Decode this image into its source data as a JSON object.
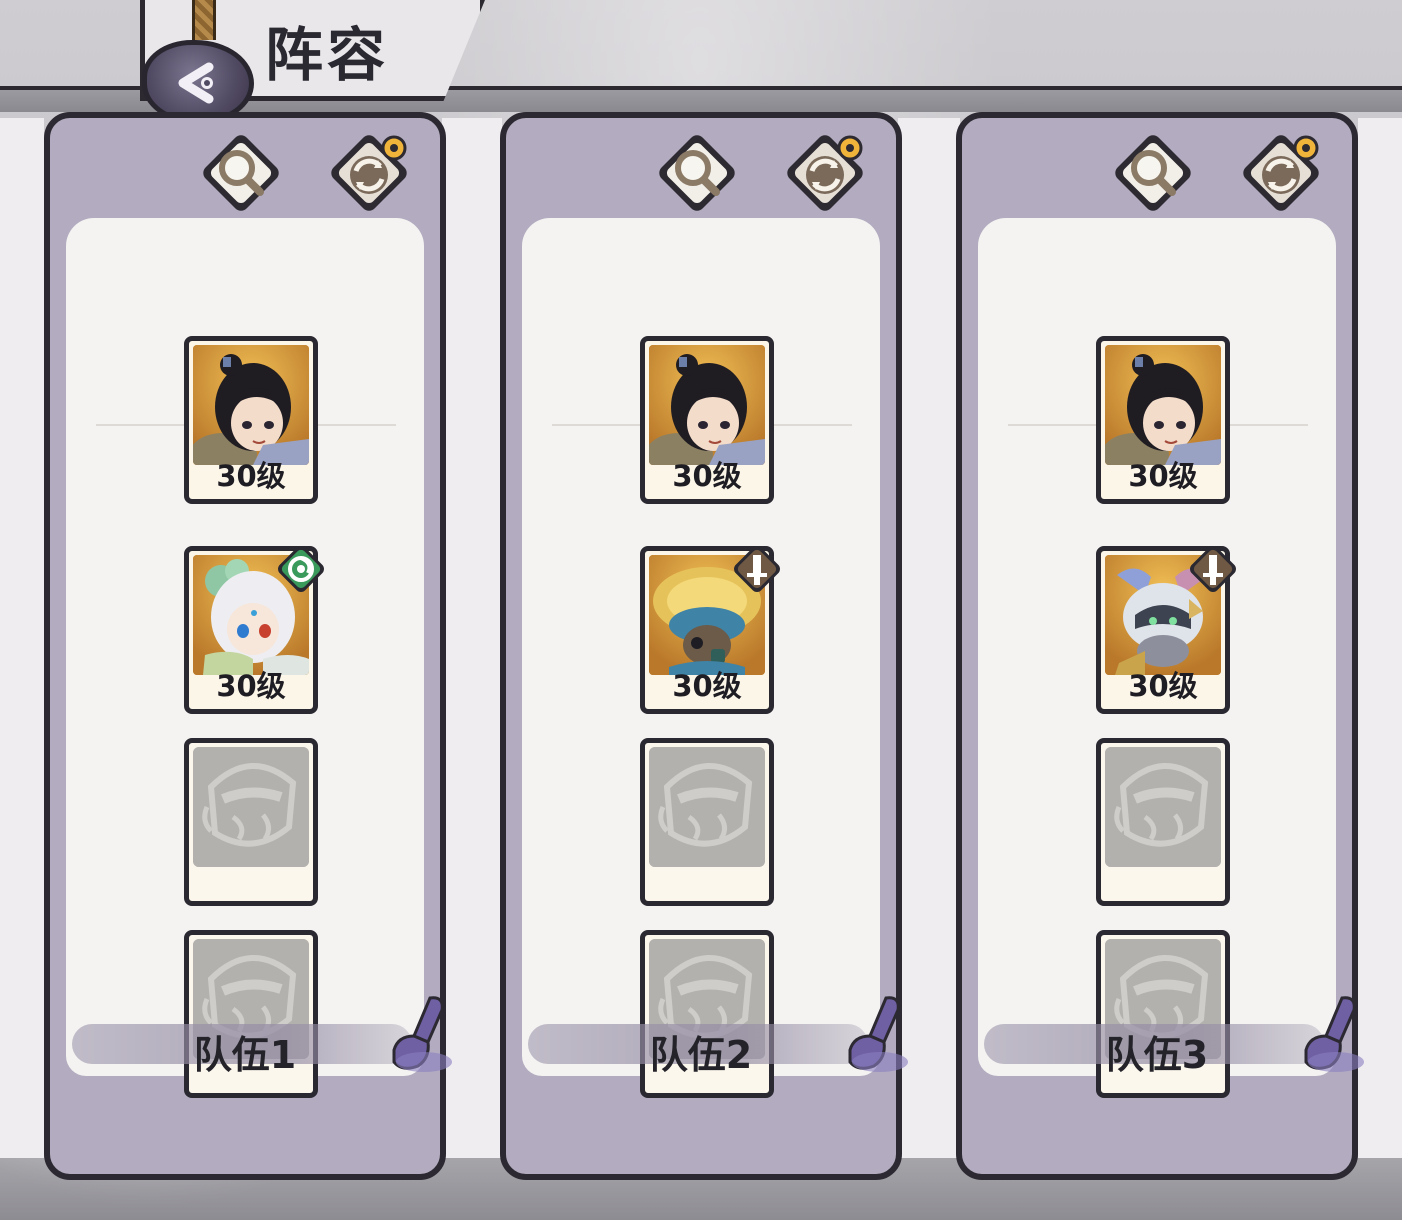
{
  "header": {
    "title": "阵容"
  },
  "teams": [
    {
      "name": "队伍1",
      "heroes": [
        {
          "level": "30级",
          "portrait": "hero-girl-black-hair"
        },
        {
          "level": "30级",
          "portrait": "hero-white-hair-clover",
          "class_icon": "wind-swirl-icon"
        }
      ],
      "empty_slots": 2
    },
    {
      "name": "队伍2",
      "heroes": [
        {
          "level": "30级",
          "portrait": "hero-girl-black-hair"
        },
        {
          "level": "30级",
          "portrait": "hero-blue-turban-gasmask",
          "class_icon": "sword-icon"
        }
      ],
      "empty_slots": 2
    },
    {
      "name": "队伍3",
      "heroes": [
        {
          "level": "30级",
          "portrait": "hero-girl-black-hair"
        },
        {
          "level": "30级",
          "portrait": "hero-white-helmet-masked",
          "class_icon": "sword-icon"
        }
      ],
      "empty_slots": 2
    }
  ],
  "colors": {
    "panel": "#b3acc0",
    "panel_inner": "#f4f3f1",
    "outline": "#2c2932",
    "edit_accent": "#6f5fa3",
    "badge_wind": "#3a9a5c",
    "badge_sword": "#6f5844"
  }
}
